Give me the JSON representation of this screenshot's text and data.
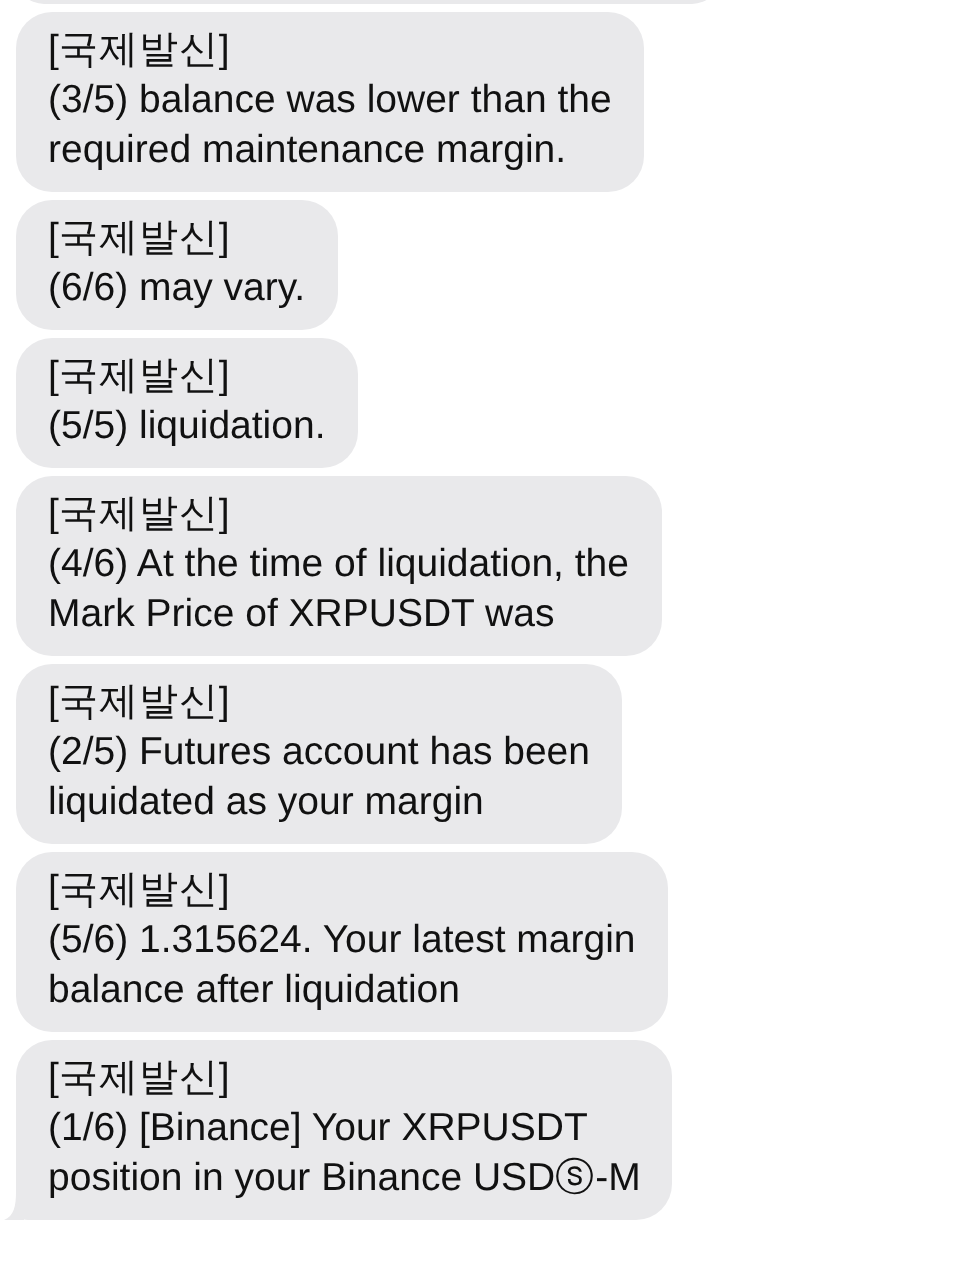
{
  "messages": [
    {
      "sender": "[국제발신]",
      "text": "(3/5) balance was lower than the\nrequired maintenance margin.",
      "tail": false
    },
    {
      "sender": "[국제발신]",
      "text": "(6/6) may vary.",
      "tail": false
    },
    {
      "sender": "[국제발신]",
      "text": "(5/5) liquidation.",
      "tail": false
    },
    {
      "sender": "[국제발신]",
      "text": "(4/6) At the time of liquidation, the\nMark Price of XRPUSDT was",
      "tail": false
    },
    {
      "sender": "[국제발신]",
      "text": "(2/5) Futures account has been\nliquidated as your margin",
      "tail": false
    },
    {
      "sender": "[국제발신]",
      "text": "(5/6)  1.315624. Your latest margin\nbalance after liquidation",
      "tail": false
    },
    {
      "sender": "[국제발신]",
      "text": "(1/6) [Binance] Your XRPUSDT\nposition in your Binance USDⓢ-M",
      "tail": true
    }
  ]
}
